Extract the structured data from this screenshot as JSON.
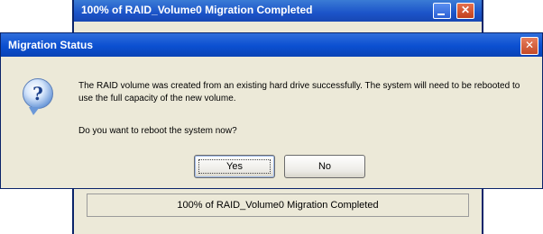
{
  "background_window": {
    "title": "100% of RAID_Volume0 Migration Completed",
    "close_glyph": "✕",
    "status_text": "100% of RAID_Volume0 Migration Completed"
  },
  "dialog": {
    "title": "Migration Status",
    "close_glyph": "✕",
    "icon": "question-icon",
    "icon_glyph": "?",
    "message": "The RAID volume was created from an existing hard drive successfully. The system will need to be rebooted to use the full capacity of the new volume.",
    "question": "Do you want to reboot the system now?",
    "buttons": {
      "yes": "Yes",
      "no": "No"
    }
  }
}
